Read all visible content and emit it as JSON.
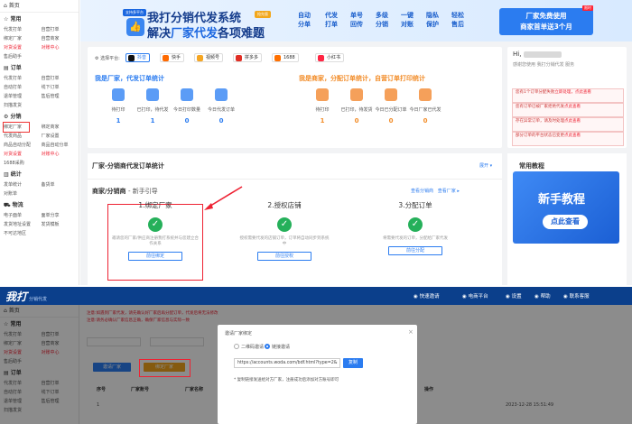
{
  "sidebar": {
    "home": "首页",
    "sections": [
      {
        "title": "常用",
        "icon": "star-icon",
        "items": [
          {
            "label": "代发打单",
            "active": false
          },
          {
            "label": "自营打单",
            "active": false
          },
          {
            "label": "绑定厂家",
            "active": false
          },
          {
            "label": "自营商家",
            "active": false
          },
          {
            "label": "对货设置",
            "active": true
          },
          {
            "label": "对账中心",
            "active": true
          },
          {
            "label": "售后助手",
            "active": false
          }
        ]
      },
      {
        "title": "订单",
        "icon": "doc-icon",
        "items": [
          {
            "label": "代发打单",
            "active": false
          },
          {
            "label": "自营打单",
            "active": false
          },
          {
            "label": "自动打单",
            "active": false
          },
          {
            "label": "线下订单",
            "active": false
          },
          {
            "label": "退单管理",
            "active": false
          },
          {
            "label": "售后管理",
            "active": false
          },
          {
            "label": "扫描发货",
            "active": false
          }
        ]
      },
      {
        "title": "分销",
        "icon": "gear-icon",
        "items": [
          {
            "label": "绑定厂家",
            "active": false,
            "boxed": true
          },
          {
            "label": "绑定商家",
            "active": false
          },
          {
            "label": "代发商品",
            "active": false
          },
          {
            "label": "厂家设置",
            "active": false
          },
          {
            "label": "商品自动分配",
            "active": false
          },
          {
            "label": "商品自动分单",
            "active": false
          },
          {
            "label": "对货设置",
            "active": true
          },
          {
            "label": "对账中心",
            "active": true
          },
          {
            "label": "1688采购",
            "active": false
          }
        ]
      },
      {
        "title": "统计",
        "icon": "chart-icon",
        "items": [
          {
            "label": "发单统计",
            "active": false
          },
          {
            "label": "备货单",
            "active": false
          },
          {
            "label": "对账单",
            "active": false
          }
        ]
      },
      {
        "title": "物流",
        "icon": "truck-icon",
        "items": [
          {
            "label": "电子面单",
            "active": false
          },
          {
            "label": "面单分享",
            "active": false
          },
          {
            "label": "发货地址设置",
            "active": false
          },
          {
            "label": "发货模板",
            "active": false
          },
          {
            "label": "不可达地区",
            "active": false
          }
        ]
      }
    ]
  },
  "banner": {
    "tag1": "支持多平台",
    "tag2": "抢先版",
    "line1": "我打分销代发系统",
    "line2a": "解决",
    "line2b": "厂家代发",
    "line2c": "各项难题",
    "features": [
      [
        "自动",
        "分单"
      ],
      [
        "代发",
        "打单"
      ],
      [
        "单号",
        "回传"
      ],
      [
        "多级",
        "分销"
      ],
      [
        "一键",
        "对账"
      ],
      [
        "隐私",
        "保护"
      ],
      [
        "轻松",
        "售后"
      ]
    ],
    "cta1": "厂家免费使用",
    "cta2": "商家首单送3个月",
    "cta_tag": "限时"
  },
  "platform": {
    "label": "选择平台:",
    "items": [
      {
        "name": "抖音",
        "color": "#111111",
        "selected": true
      },
      {
        "name": "快手",
        "color": "#ff6a00",
        "selected": false
      },
      {
        "name": "视频号",
        "color": "#f5a623",
        "selected": false
      },
      {
        "name": "拼多多",
        "color": "#e02e24",
        "selected": false
      },
      {
        "name": "1688",
        "color": "#ff7000",
        "selected": false
      },
      {
        "name": "小红书",
        "color": "#ff2442",
        "selected": false
      }
    ]
  },
  "factory_stats": {
    "title": "我是厂家，代发订单统计",
    "color": "#2b7cf0",
    "items": [
      {
        "label": "待打印",
        "value": "1"
      },
      {
        "label": "已打印，待代发",
        "value": "1"
      },
      {
        "label": "今日打印数量",
        "value": "0"
      },
      {
        "label": "今日代发订单",
        "value": "0"
      }
    ]
  },
  "merchant_stats": {
    "title": "我是商家，分配订单统计，自营订单打印统计",
    "color": "#f28c28",
    "items": [
      {
        "label": "待打印",
        "value": "1"
      },
      {
        "label": "已打印，待发货",
        "value": "0"
      },
      {
        "label": "今日已分配订单",
        "value": "0"
      },
      {
        "label": "今日厂家已代发",
        "value": "0"
      }
    ]
  },
  "user_panel": {
    "greeting": "Hi,",
    "welcome": "感谢您使用 我打分销代发 服务",
    "notices": [
      {
        "text": "您有1个订单分配失败",
        "link": "立即处理，点此查看"
      },
      {
        "text": "您有订单已被厂家拒绝代发",
        "link": "点此查看"
      },
      {
        "text": "存在异常订单，请及时处理",
        "link": "点此查看"
      },
      {
        "text": "部分订单的平台状态已变更",
        "link": "点此查看"
      }
    ]
  },
  "order_stats": {
    "title": "厂家-分销商代发订单统计",
    "more": "展开",
    "guide_title": "商家/分销商",
    "guide_sub": "- 新手引导",
    "links": "查看分销商",
    "links2": "查看厂家",
    "steps": [
      {
        "title": "1.绑定厂家",
        "desc": "邀请您的厂家/供应商注册我打系统并与您建立合作关系",
        "button": "前往绑定"
      },
      {
        "title": "2.授权店铺",
        "desc": "授权需要代发的店铺订单，订单将自动同步到系统中",
        "button": "前往授权"
      },
      {
        "title": "3.分配订单",
        "desc": "将需要代发的订单，分配给厂家代发",
        "button": "前往分配"
      }
    ]
  },
  "tutorial": {
    "heading": "常用教程",
    "title": "新手教程",
    "button": "点此查看"
  },
  "topbar": {
    "logo": "我打",
    "logo_sub": "分销代发",
    "items": [
      "快速邀请",
      "电商平台",
      "设置",
      "帮助",
      "联系客服"
    ]
  },
  "main2": {
    "warn1": "注意:如遇到厂家代发，请先确认好厂家后再分配订单，代发后将无法修改",
    "warn2": "注意:请务必确认厂家信息正确，确保厂家信息与实际一致",
    "btn_invite": "邀请厂家",
    "btn_bind": "绑定厂家",
    "table_headers": [
      "序号",
      "厂家账号",
      "厂家名称",
      "状态",
      "操作"
    ],
    "row": {
      "no": "1",
      "time": "2023-12-28 15:51:49"
    }
  },
  "dialog": {
    "title": "邀请厂家绑定",
    "close": "×",
    "option1": "二维码邀请",
    "option2": "链接邀请",
    "url": "https://accounts.woda.com/bdf.html?type=2&",
    "copy": "复制",
    "tip": "* 复制链接发送给对方厂家，注册成功后添加对方账号即可"
  }
}
